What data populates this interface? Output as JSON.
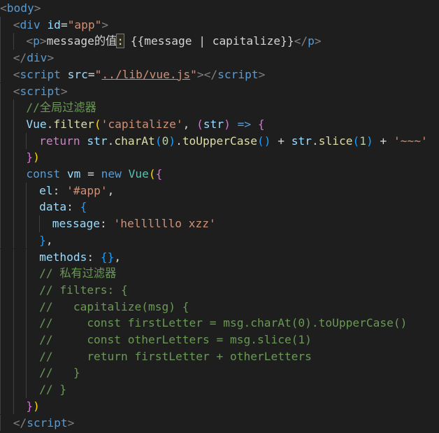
{
  "editor": {
    "language": "html",
    "theme": "dark",
    "lines": [
      {
        "indent": 0,
        "tokens": [
          {
            "t": "<",
            "c": "punc"
          },
          {
            "t": "body",
            "c": "tag"
          },
          {
            "t": ">",
            "c": "punc"
          }
        ]
      },
      {
        "indent": 1,
        "tokens": [
          {
            "t": "<",
            "c": "punc"
          },
          {
            "t": "div",
            "c": "tag"
          },
          {
            "t": " ",
            "c": "text"
          },
          {
            "t": "id",
            "c": "attr"
          },
          {
            "t": "=",
            "c": "text"
          },
          {
            "t": "\"app\"",
            "c": "str"
          },
          {
            "t": ">",
            "c": "punc"
          }
        ]
      },
      {
        "indent": 2,
        "tokens": [
          {
            "t": "<",
            "c": "punc"
          },
          {
            "t": "p",
            "c": "tag"
          },
          {
            "t": ">",
            "c": "punc"
          },
          {
            "t": "message的值",
            "c": "text"
          },
          {
            "t": ":",
            "c": "text",
            "hl": true
          },
          {
            "t": " {{message | capitalize}}",
            "c": "text"
          },
          {
            "t": "</",
            "c": "punc"
          },
          {
            "t": "p",
            "c": "tag"
          },
          {
            "t": ">",
            "c": "punc"
          }
        ]
      },
      {
        "indent": 1,
        "tokens": [
          {
            "t": "</",
            "c": "punc"
          },
          {
            "t": "div",
            "c": "tag"
          },
          {
            "t": ">",
            "c": "punc"
          }
        ]
      },
      {
        "indent": 1,
        "tokens": [
          {
            "t": "<",
            "c": "punc"
          },
          {
            "t": "script",
            "c": "tag"
          },
          {
            "t": " ",
            "c": "text"
          },
          {
            "t": "src",
            "c": "attr"
          },
          {
            "t": "=",
            "c": "text"
          },
          {
            "t": "\"",
            "c": "str"
          },
          {
            "t": "../lib/vue.js",
            "c": "str",
            "link": true
          },
          {
            "t": "\"",
            "c": "str"
          },
          {
            "t": ">",
            "c": "punc"
          },
          {
            "t": "</",
            "c": "punc"
          },
          {
            "t": "script",
            "c": "tag"
          },
          {
            "t": ">",
            "c": "punc"
          }
        ]
      },
      {
        "indent": 1,
        "tokens": [
          {
            "t": "<",
            "c": "punc"
          },
          {
            "t": "script",
            "c": "tag"
          },
          {
            "t": ">",
            "c": "punc"
          }
        ]
      },
      {
        "indent": 2,
        "tokens": [
          {
            "t": "//全局过滤器",
            "c": "cmt"
          }
        ]
      },
      {
        "indent": 2,
        "tokens": [
          {
            "t": "Vue",
            "c": "var"
          },
          {
            "t": ".",
            "c": "text"
          },
          {
            "t": "filter",
            "c": "fn"
          },
          {
            "t": "(",
            "c": "y"
          },
          {
            "t": "'capitalize'",
            "c": "str"
          },
          {
            "t": ", ",
            "c": "text"
          },
          {
            "t": "(",
            "c": "p"
          },
          {
            "t": "str",
            "c": "var"
          },
          {
            "t": ")",
            "c": "p"
          },
          {
            "t": " => ",
            "c": "kw"
          },
          {
            "t": "{",
            "c": "p"
          }
        ]
      },
      {
        "indent": 3,
        "tokens": [
          {
            "t": "return",
            "c": "ctl"
          },
          {
            "t": " ",
            "c": "text"
          },
          {
            "t": "str",
            "c": "var"
          },
          {
            "t": ".",
            "c": "text"
          },
          {
            "t": "charAt",
            "c": "fn"
          },
          {
            "t": "(",
            "c": "b"
          },
          {
            "t": "0",
            "c": "num"
          },
          {
            "t": ")",
            "c": "b"
          },
          {
            "t": ".",
            "c": "text"
          },
          {
            "t": "toUpperCase",
            "c": "fn"
          },
          {
            "t": "()",
            "c": "b"
          },
          {
            "t": " + ",
            "c": "text"
          },
          {
            "t": "str",
            "c": "var"
          },
          {
            "t": ".",
            "c": "text"
          },
          {
            "t": "slice",
            "c": "fn"
          },
          {
            "t": "(",
            "c": "b"
          },
          {
            "t": "1",
            "c": "num"
          },
          {
            "t": ")",
            "c": "b"
          },
          {
            "t": " + ",
            "c": "text"
          },
          {
            "t": "'~~~'",
            "c": "str"
          }
        ]
      },
      {
        "indent": 2,
        "tokens": [
          {
            "t": "}",
            "c": "p"
          },
          {
            "t": ")",
            "c": "y"
          }
        ]
      },
      {
        "indent": 2,
        "tokens": [
          {
            "t": "const",
            "c": "kw"
          },
          {
            "t": " ",
            "c": "text"
          },
          {
            "t": "vm",
            "c": "var"
          },
          {
            "t": " = ",
            "c": "text"
          },
          {
            "t": "new",
            "c": "kw"
          },
          {
            "t": " ",
            "c": "text"
          },
          {
            "t": "Vue",
            "c": "cls"
          },
          {
            "t": "(",
            "c": "y"
          },
          {
            "t": "{",
            "c": "p"
          }
        ]
      },
      {
        "indent": 3,
        "tokens": [
          {
            "t": "el",
            "c": "var"
          },
          {
            "t": ": ",
            "c": "text"
          },
          {
            "t": "'#app'",
            "c": "str"
          },
          {
            "t": ",",
            "c": "text"
          }
        ]
      },
      {
        "indent": 3,
        "tokens": [
          {
            "t": "data",
            "c": "var"
          },
          {
            "t": ": ",
            "c": "text"
          },
          {
            "t": "{",
            "c": "b"
          }
        ]
      },
      {
        "indent": 4,
        "tokens": [
          {
            "t": "message",
            "c": "var"
          },
          {
            "t": ": ",
            "c": "text"
          },
          {
            "t": "'hellllllo xzz'",
            "c": "str"
          }
        ]
      },
      {
        "indent": 3,
        "tokens": [
          {
            "t": "}",
            "c": "b"
          },
          {
            "t": ",",
            "c": "text"
          }
        ]
      },
      {
        "indent": 3,
        "tokens": [
          {
            "t": "methods",
            "c": "var"
          },
          {
            "t": ": ",
            "c": "text"
          },
          {
            "t": "{}",
            "c": "b"
          },
          {
            "t": ",",
            "c": "text"
          }
        ]
      },
      {
        "indent": 3,
        "tokens": [
          {
            "t": "// 私有过滤器",
            "c": "cmt"
          }
        ]
      },
      {
        "indent": 3,
        "tokens": [
          {
            "t": "// filters: {",
            "c": "cmt"
          }
        ]
      },
      {
        "indent": 3,
        "tokens": [
          {
            "t": "//   capitalize(msg) {",
            "c": "cmt"
          }
        ]
      },
      {
        "indent": 3,
        "tokens": [
          {
            "t": "//     const firstLetter = msg.charAt(0).toUpperCase()",
            "c": "cmt"
          }
        ]
      },
      {
        "indent": 3,
        "tokens": [
          {
            "t": "//     const otherLetters = msg.slice(1)",
            "c": "cmt"
          }
        ]
      },
      {
        "indent": 3,
        "tokens": [
          {
            "t": "//     return firstLetter + otherLetters",
            "c": "cmt"
          }
        ]
      },
      {
        "indent": 3,
        "tokens": [
          {
            "t": "//   }",
            "c": "cmt"
          }
        ]
      },
      {
        "indent": 3,
        "tokens": [
          {
            "t": "// }",
            "c": "cmt"
          }
        ]
      },
      {
        "indent": 2,
        "tokens": [
          {
            "t": "}",
            "c": "p"
          },
          {
            "t": ")",
            "c": "y"
          }
        ]
      },
      {
        "indent": 1,
        "tokens": [
          {
            "t": "</",
            "c": "punc"
          },
          {
            "t": "script",
            "c": "tag"
          },
          {
            "t": ">",
            "c": "punc"
          }
        ]
      }
    ]
  },
  "colors": {
    "background": "#1e1e1e",
    "punc": "#808080",
    "tag": "#569cd6",
    "attr": "#9cdcfe",
    "string": "#ce9178",
    "comment": "#6a9955",
    "function": "#dcdcaa",
    "keyword": "#569cd6",
    "control": "#c586c0",
    "class": "#4ec9b0",
    "number": "#b5cea8",
    "bracket1": "#ffd700",
    "bracket2": "#da70d6",
    "bracket3": "#179fff"
  }
}
